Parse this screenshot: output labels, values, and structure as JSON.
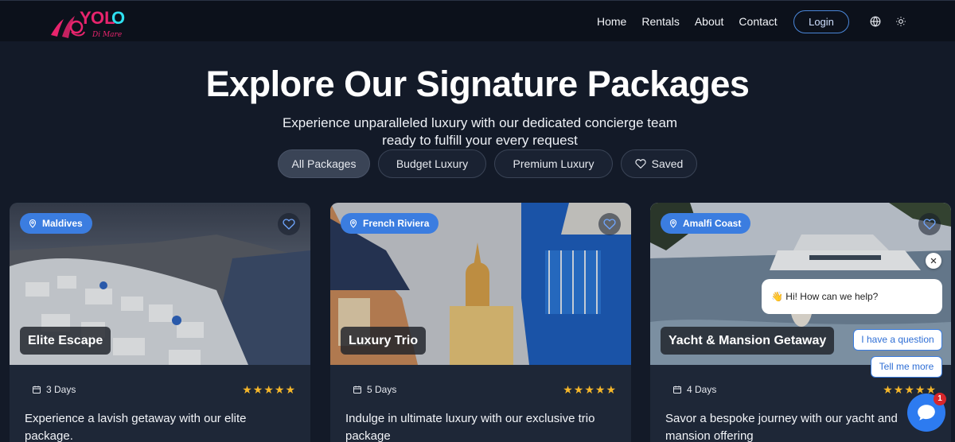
{
  "brand": {
    "logo_text": "YOLO",
    "logo_script": "Di Mare"
  },
  "nav": {
    "links": [
      "Home",
      "Rentals",
      "About",
      "Contact"
    ],
    "login_label": "Login",
    "icons": [
      "globe-icon",
      "sun-icon"
    ]
  },
  "hero": {
    "title": "Explore Our Signature Packages",
    "subtitle_line1": "Experience unparalleled luxury with our dedicated concierge team",
    "subtitle_line2": "ready to fulfill your every request"
  },
  "filters": [
    {
      "label": "All Packages",
      "active": true
    },
    {
      "label": "Budget Luxury",
      "active": false
    },
    {
      "label": "Premium Luxury",
      "active": false
    },
    {
      "label": "Saved",
      "active": false,
      "icon": "heart-icon"
    }
  ],
  "cards": [
    {
      "location": "Maldives",
      "title": "Elite Escape",
      "days": "3 Days",
      "rating": 5,
      "description": "Experience a lavish getaway with our elite package."
    },
    {
      "location": "French Riviera",
      "title": "Luxury Trio",
      "days": "5 Days",
      "rating": 5,
      "description": "Indulge in ultimate luxury with our exclusive trio package"
    },
    {
      "location": "Amalfi Coast",
      "title": "Yacht & Mansion Getaway",
      "days": "4 Days",
      "rating": 5,
      "description": "Savor a bespoke journey with our yacht and mansion offering"
    }
  ],
  "chat": {
    "greeting": "👋 Hi! How can we help?",
    "reply_1": "I have a question",
    "reply_2": "Tell me more",
    "unread_count": "1"
  },
  "colors": {
    "background": "#131a28",
    "accent": "#3b7de0",
    "star": "#f6b72a",
    "logo_pink": "#e8246d",
    "logo_cyan": "#2ee0f0"
  }
}
